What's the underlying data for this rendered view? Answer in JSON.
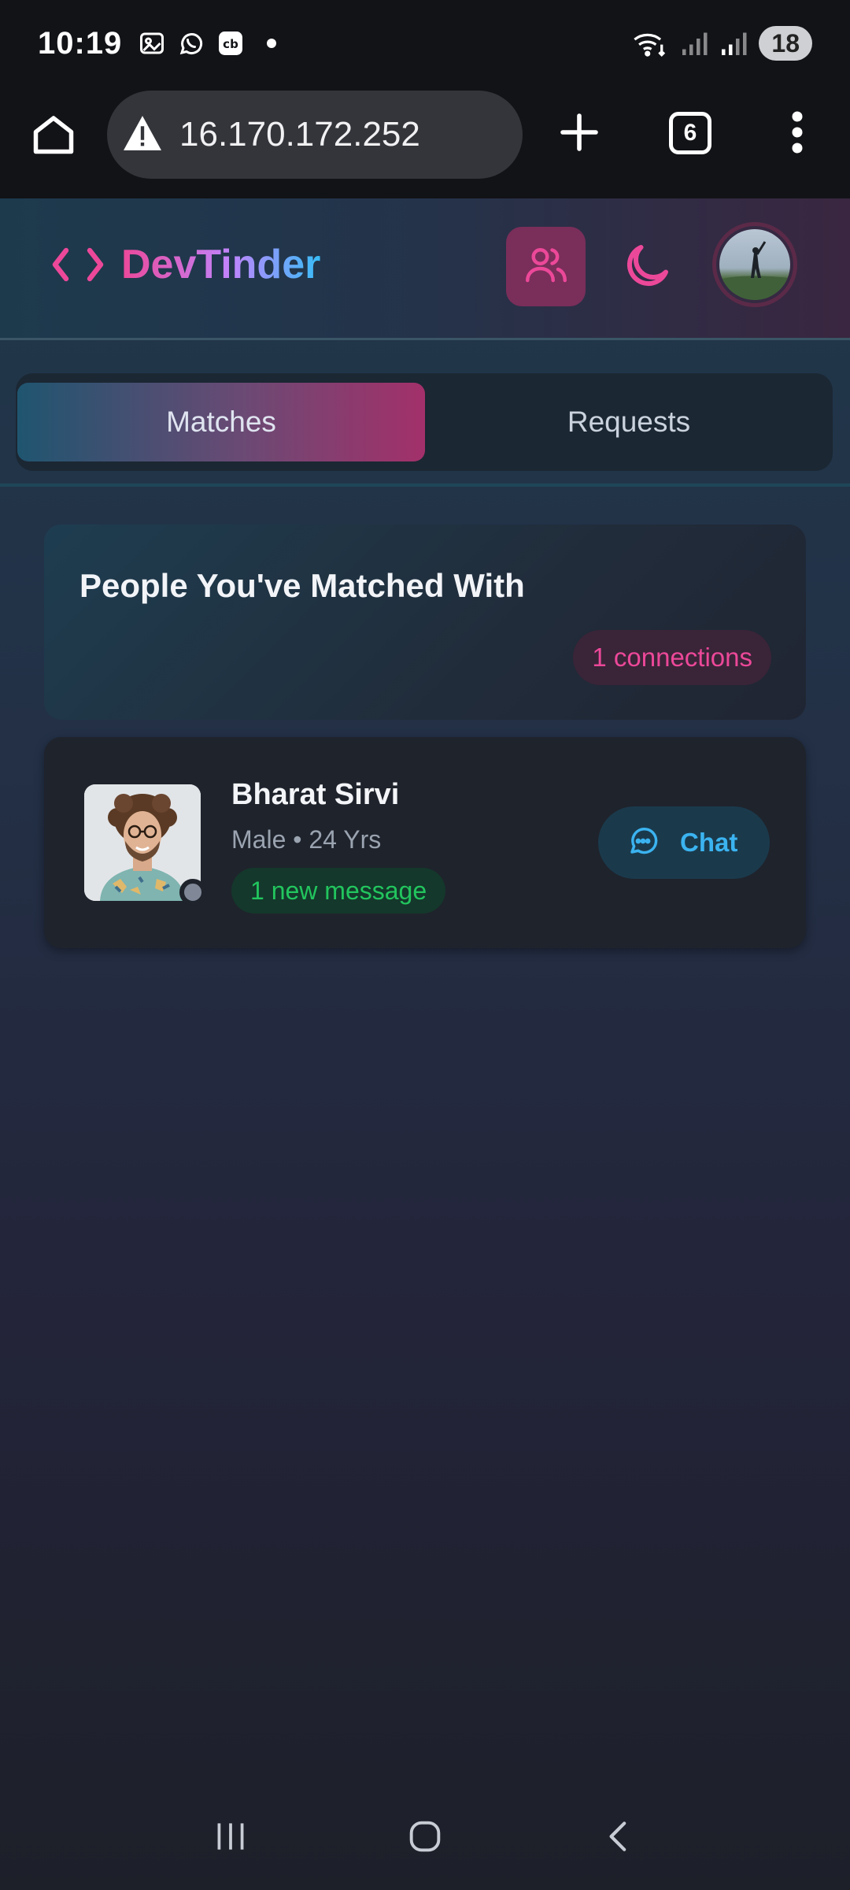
{
  "status_bar": {
    "time": "10:19",
    "battery": "18",
    "icons": [
      "gallery-icon",
      "whatsapp-icon",
      "cb-icon",
      "wifi-icon",
      "signal-icon",
      "signal-icon"
    ]
  },
  "browser": {
    "url": "16.170.172.252",
    "tab_count": "6",
    "security": "warning-icon"
  },
  "app": {
    "brand": "DevTinder",
    "accent": "#ec4899",
    "secondary": "#38bdf8"
  },
  "tabs": [
    {
      "label": "Matches",
      "active": true
    },
    {
      "label": "Requests",
      "active": false
    }
  ],
  "matches_header": {
    "title": "People You've Matched With",
    "count_label": "1 connections"
  },
  "matches": [
    {
      "name": "Bharat Sirvi",
      "meta": "Male • 24 Yrs",
      "badge": "1 new message",
      "action": "Chat"
    }
  ]
}
